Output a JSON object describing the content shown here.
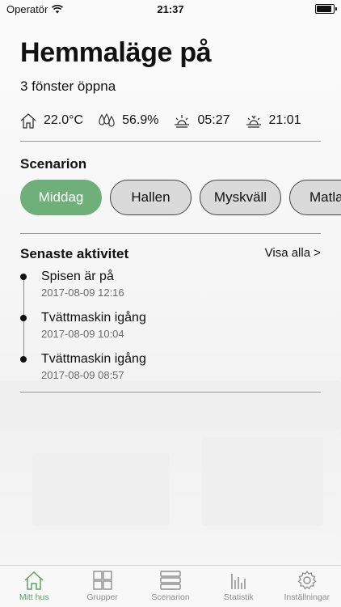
{
  "status_bar": {
    "carrier": "Operatör",
    "time": "21:37"
  },
  "header": {
    "title": "Hemmaläge på",
    "subtitle": "3 fönster öppna"
  },
  "stats": [
    {
      "icon": "home-icon",
      "value": "22.0°C"
    },
    {
      "icon": "humidity-icon",
      "value": "56.9%"
    },
    {
      "icon": "sunrise-icon",
      "value": "05:27"
    },
    {
      "icon": "sunset-icon",
      "value": "21:01"
    }
  ],
  "scenarios": {
    "title": "Scenarion",
    "items": [
      "Middag",
      "Hallen",
      "Myskväll",
      "Matlag"
    ],
    "active": "Middag"
  },
  "activity": {
    "title": "Senaste aktivitet",
    "see_all": "Visa alla >",
    "items": [
      {
        "name": "Spisen är på",
        "time": "2017-08-09 12:16"
      },
      {
        "name": "Tvättmaskin igång",
        "time": "2017-08-09 10:04"
      },
      {
        "name": "Tvättmaskin igång",
        "time": "2017-08-09 08:57"
      }
    ]
  },
  "tabbar": {
    "items": [
      "Mitt hus",
      "Grupper",
      "Scenarion",
      "Statistik",
      "Inställningar"
    ],
    "active": "Mitt hus"
  },
  "colors": {
    "accent": "#6fb07a",
    "tab_active": "#5aa265",
    "chip_inactive": "#dadada"
  }
}
